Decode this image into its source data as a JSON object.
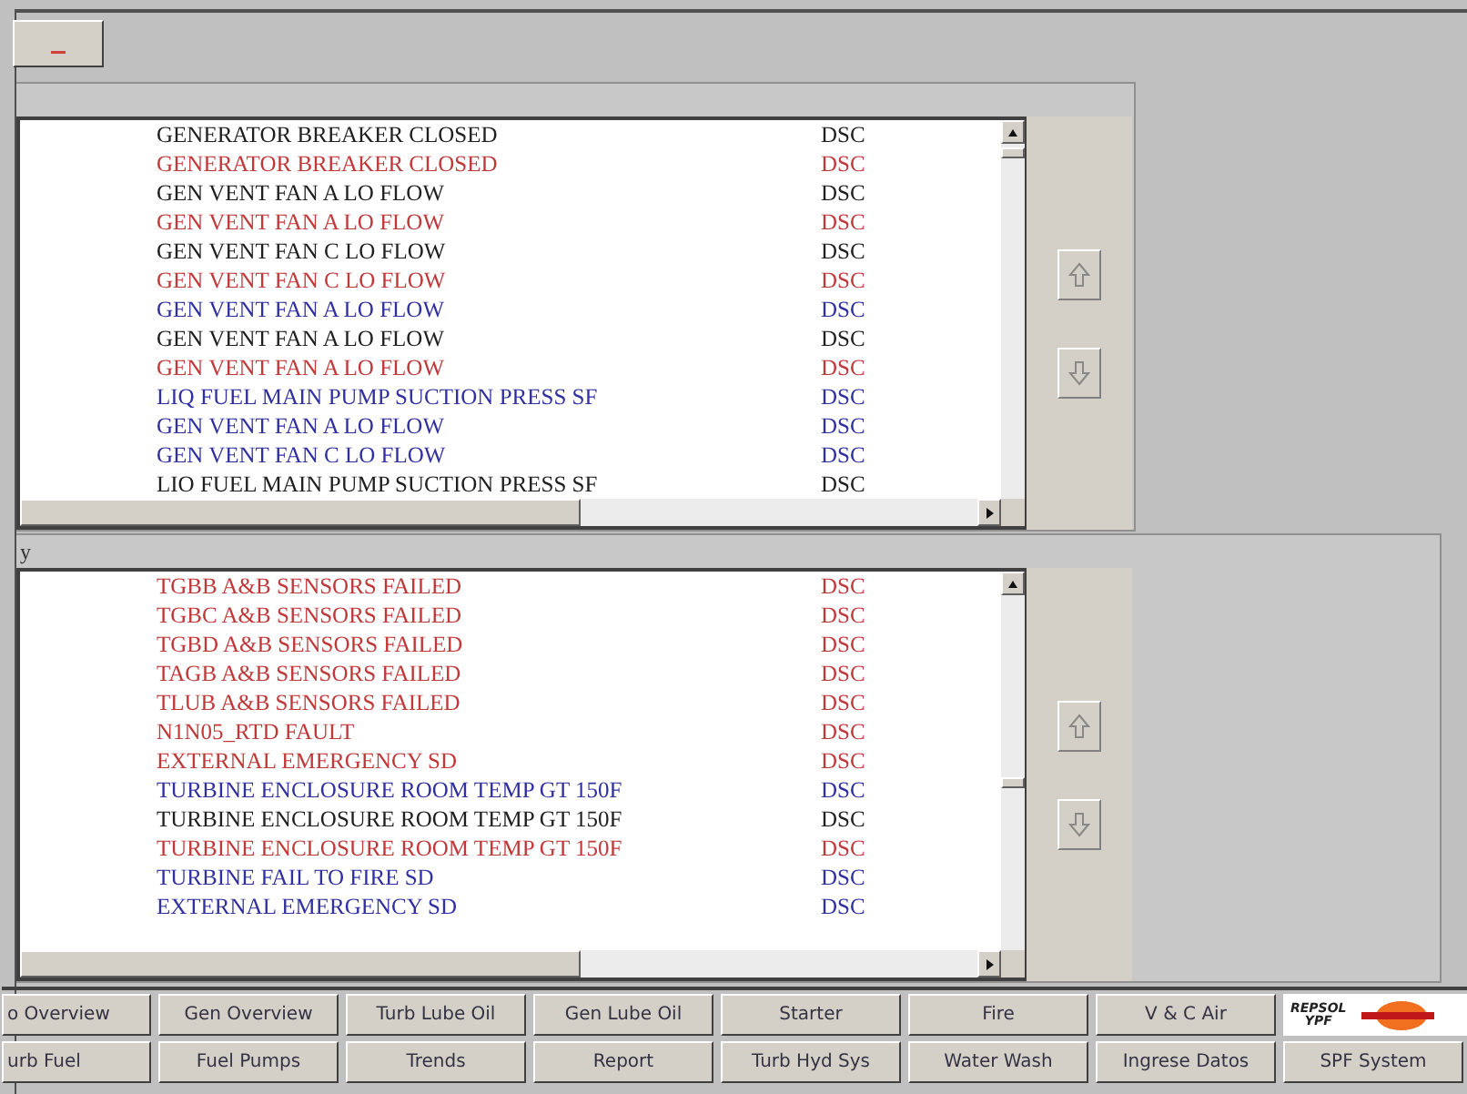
{
  "panels": [
    {
      "rows": [
        {
          "text": "GENERATOR BREAKER CLOSED",
          "status": "DSC",
          "color": "#202020"
        },
        {
          "text": "GENERATOR BREAKER CLOSED",
          "status": "DSC",
          "color": "#c03838"
        },
        {
          "text": "GEN VENT FAN A LO FLOW",
          "status": "DSC",
          "color": "#202020"
        },
        {
          "text": "GEN VENT FAN A LO FLOW",
          "status": "DSC",
          "color": "#c03838"
        },
        {
          "text": "GEN VENT FAN C LO FLOW",
          "status": "DSC",
          "color": "#202020"
        },
        {
          "text": "GEN VENT FAN C LO FLOW",
          "status": "DSC",
          "color": "#c03838"
        },
        {
          "text": "GEN VENT FAN A LO FLOW",
          "status": "DSC",
          "color": "#3030a0"
        },
        {
          "text": "GEN VENT FAN A LO FLOW",
          "status": "DSC",
          "color": "#202020"
        },
        {
          "text": "GEN VENT FAN A LO FLOW",
          "status": "DSC",
          "color": "#c03838"
        },
        {
          "text": "LIQ FUEL MAIN PUMP SUCTION PRESS SF",
          "status": "DSC",
          "color": "#3030a0"
        },
        {
          "text": "GEN VENT FAN A LO FLOW",
          "status": "DSC",
          "color": "#3030a0"
        },
        {
          "text": "GEN VENT FAN C LO FLOW",
          "status": "DSC",
          "color": "#3030a0"
        },
        {
          "text": "LIO FUEL MAIN PUMP SUCTION PRESS SF",
          "status": "DSC",
          "color": "#202020"
        }
      ]
    },
    {
      "header": "y",
      "rows": [
        {
          "text": "TGBB A&B SENSORS FAILED",
          "status": "DSC",
          "color": "#c03838"
        },
        {
          "text": "TGBC A&B SENSORS FAILED",
          "status": "DSC",
          "color": "#c03838"
        },
        {
          "text": "TGBD A&B SENSORS FAILED",
          "status": "DSC",
          "color": "#c03838"
        },
        {
          "text": "TAGB A&B SENSORS FAILED",
          "status": "DSC",
          "color": "#c03838"
        },
        {
          "text": "TLUB A&B SENSORS FAILED",
          "status": "DSC",
          "color": "#c03838"
        },
        {
          "text": "N1N05_RTD FAULT",
          "status": "DSC",
          "color": "#c03838"
        },
        {
          "text": "EXTERNAL EMERGENCY SD",
          "status": "DSC",
          "color": "#c03838"
        },
        {
          "text": "TURBINE ENCLOSURE ROOM TEMP GT 150F",
          "status": "DSC",
          "color": "#3030a0"
        },
        {
          "text": "TURBINE ENCLOSURE ROOM TEMP GT 150F",
          "status": "DSC",
          "color": "#202020"
        },
        {
          "text": "TURBINE ENCLOSURE ROOM TEMP GT 150F",
          "status": "DSC",
          "color": "#c03838"
        },
        {
          "text": "TURBINE FAIL TO FIRE SD",
          "status": "DSC",
          "color": "#3030a0"
        },
        {
          "text": "EXTERNAL EMERGENCY SD",
          "status": "DSC",
          "color": "#3030a0"
        }
      ]
    }
  ],
  "nav_rows": [
    [
      "o Overview",
      "Gen Overview",
      "Turb Lube Oil",
      "Gen Lube Oil",
      "Starter",
      "Fire",
      "V & C Air"
    ],
    [
      "urb Fuel",
      "Fuel Pumps",
      "Trends",
      "Report",
      "Turb Hyd Sys",
      "Water Wash",
      "Ingrese Datos",
      "SPF System"
    ]
  ],
  "logo": {
    "line_1": "REPSOL",
    "line_2": "YPF"
  }
}
